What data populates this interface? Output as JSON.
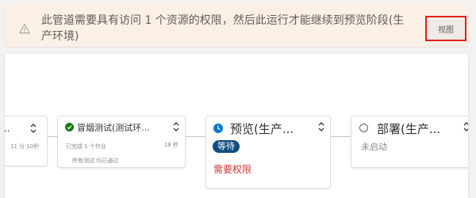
{
  "banner": {
    "message": "此管道需要具有访问 1 个资源的权限，然后此运行才能继续到预览阶段(生产环境)",
    "view_button": "视图",
    "icon": "warning-icon",
    "colors": {
      "background": "#fbf0e6",
      "button_border": "#e0201a"
    }
  },
  "stages": [
    {
      "name": "...",
      "duration": "11 分 10秒"
    },
    {
      "name": "冒烟测试(测试环...",
      "status_icon": "success-check-icon",
      "duration": "18 秒",
      "jobs": "已完成 1 个作业",
      "tests": "所有测试 均已通过"
    },
    {
      "name": "预览(生产...",
      "status_icon": "clock-icon",
      "badge": "等待",
      "message": "需要权限"
    },
    {
      "name": "部署(生产...",
      "status_icon": "not-started-icon",
      "status": "未启动"
    }
  ],
  "colors": {
    "success": "#107c10",
    "waiting_badge": "#0f4c81",
    "clock": "#0078d4",
    "error_text": "#d13438"
  }
}
